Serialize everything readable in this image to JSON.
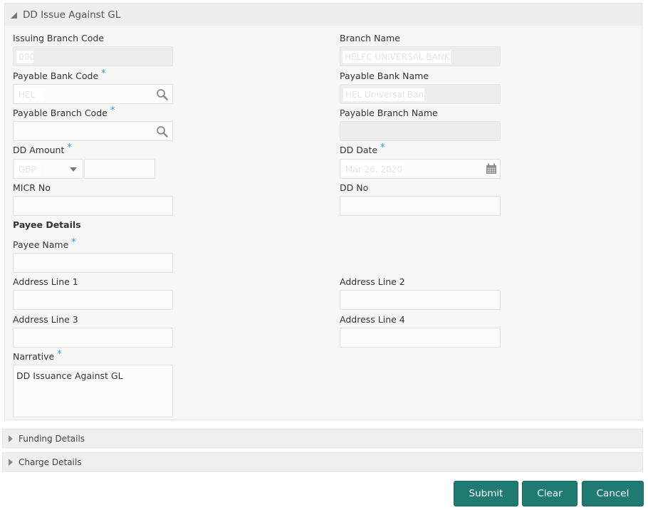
{
  "panel": {
    "title": "DD Issue Against GL",
    "collapse_state": "expanded"
  },
  "fields": {
    "issuing_branch_code": {
      "label": "Issuing Branch Code",
      "value": "000",
      "required": false,
      "readonly": true
    },
    "branch_name": {
      "label": "Branch Name",
      "value": "HELFC UNIVERSAL BANK",
      "required": false,
      "readonly": true
    },
    "payable_bank_code": {
      "label": "Payable Bank Code",
      "value": "HEL",
      "required": true,
      "icon": "search-icon"
    },
    "payable_bank_name": {
      "label": "Payable Bank Name",
      "value": "HEL Universal Bank",
      "required": false,
      "readonly": true
    },
    "payable_branch_code": {
      "label": "Payable Branch Code",
      "value": "",
      "required": true,
      "icon": "search-icon"
    },
    "payable_branch_name": {
      "label": "Payable Branch Name",
      "value": "",
      "required": false,
      "readonly": true
    },
    "dd_amount": {
      "label": "DD Amount",
      "currency": "GBP",
      "amount": "",
      "required": true
    },
    "dd_date": {
      "label": "DD Date",
      "value": "Mar 26, 2020",
      "required": true,
      "icon": "calendar-icon"
    },
    "micr_no": {
      "label": "MICR No",
      "value": ""
    },
    "dd_no": {
      "label": "DD No",
      "value": ""
    }
  },
  "payee": {
    "section_title": "Payee Details",
    "payee_name": {
      "label": "Payee Name",
      "value": "",
      "required": true
    },
    "address_line_1": {
      "label": "Address Line 1",
      "value": ""
    },
    "address_line_2": {
      "label": "Address Line 2",
      "value": ""
    },
    "address_line_3": {
      "label": "Address Line 3",
      "value": ""
    },
    "address_line_4": {
      "label": "Address Line 4",
      "value": ""
    },
    "narrative": {
      "label": "Narrative",
      "value": "DD Issuance Against GL",
      "required": true
    }
  },
  "sections": [
    {
      "title": "Funding Details",
      "state": "collapsed"
    },
    {
      "title": "Charge Details",
      "state": "collapsed"
    }
  ],
  "required_marker": "*",
  "buttons": {
    "submit": "Submit",
    "clear": "Clear",
    "cancel": "Cancel"
  },
  "colors": {
    "button_bg": "#1f7b72",
    "required_marker": "#2d9ad8"
  }
}
